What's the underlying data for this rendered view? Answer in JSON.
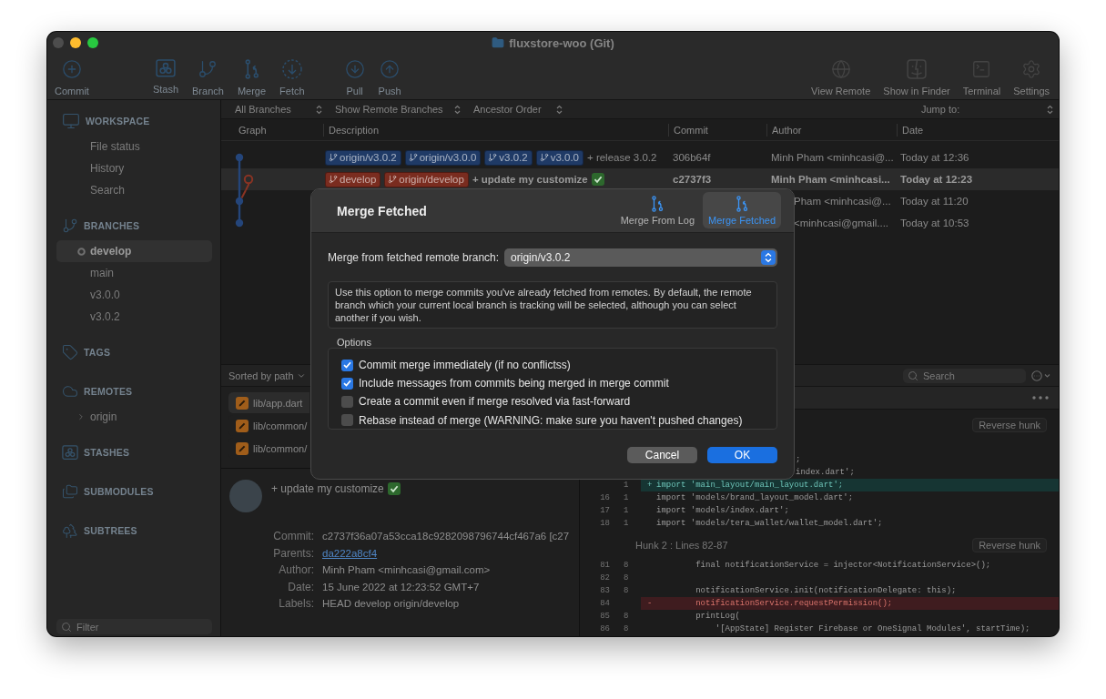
{
  "window": {
    "title": "fluxstore-woo (Git)",
    "controls": [
      {
        "kind": "close",
        "disabled": true
      },
      {
        "kind": "minimize",
        "disabled": false
      },
      {
        "kind": "zoom",
        "disabled": false
      }
    ]
  },
  "toolbar": {
    "groups": [
      [
        "Commit"
      ],
      [
        "Stash",
        "Branch",
        "Merge",
        "Fetch"
      ],
      [
        "Pull",
        "Push"
      ]
    ],
    "right": [
      "View Remote",
      "Show in Finder",
      "Terminal",
      "Settings"
    ]
  },
  "sidebar": {
    "sections": [
      {
        "title": "WORKSPACE",
        "items": [
          {
            "label": "File status",
            "selected": false
          },
          {
            "label": "History",
            "selected": false
          },
          {
            "label": "Search",
            "selected": false
          }
        ]
      },
      {
        "title": "BRANCHES",
        "items": [
          {
            "label": "develop",
            "selected": true,
            "current": true
          },
          {
            "label": "main",
            "selected": false,
            "current": false
          },
          {
            "label": "v3.0.0",
            "selected": false,
            "current": false
          },
          {
            "label": "v3.0.2",
            "selected": false,
            "current": false
          }
        ]
      },
      {
        "title": "TAGS"
      },
      {
        "title": "REMOTES",
        "items": [
          {
            "label": "origin",
            "selected": false,
            "expanded": false
          }
        ]
      },
      {
        "title": "STASHES"
      },
      {
        "title": "SUBMODULES"
      },
      {
        "title": "SUBTREES"
      }
    ],
    "filter": {
      "placeholder": "Filter"
    }
  },
  "view_options": {
    "popups": [
      "All Branches",
      "Show Remote Branches",
      "Ancestor Order"
    ],
    "jump_to": "Jump to:"
  },
  "commits": {
    "columns": [
      "Graph",
      "Description",
      "Commit",
      "Author",
      "Date"
    ],
    "rows": [
      {
        "kind": "tip",
        "refs": [
          {
            "name": "origin/v3.0.2",
            "color": "#1f3a66"
          },
          {
            "name": "origin/v3.0.0",
            "color": "#1f3a66"
          },
          {
            "name": "v3.0.2",
            "color": "#1f3a66"
          },
          {
            "name": "v3.0.0",
            "color": "#1f3a66"
          }
        ],
        "description": "+ release 3.0.2",
        "check_emoji": false,
        "commit": "306b64f",
        "author": "Minh Pham <minhcasi@...",
        "date": "Today at 12:36",
        "selected": false
      },
      {
        "kind": "fork",
        "refs": [
          {
            "name": "develop",
            "color": "#7a2c1f"
          },
          {
            "name": "origin/develop",
            "color": "#7a2c1f"
          }
        ],
        "description": "+ update my customize",
        "check_emoji": true,
        "commit": "c2737f3",
        "author": "Minh Pham <minhcasi...",
        "date": "Today at 12:23",
        "selected": true
      },
      {
        "kind": "join",
        "author": "Pham <minhcasi@...",
        "date": "Today at 11:20",
        "selected": false
      },
      {
        "kind": "end",
        "author": "<minhcasi@gmail....",
        "date": "Today at 10:53",
        "selected": false
      }
    ]
  },
  "merge_dialog": {
    "title": "Merge Fetched",
    "tabs": [
      {
        "label": "Merge From Log",
        "selected": false
      },
      {
        "label": "Merge Fetched",
        "selected": true
      }
    ],
    "branch": {
      "label": "Merge from fetched remote branch:",
      "value": "origin/v3.0.2"
    },
    "help": "Use this option to merge commits you've already fetched from remotes. By default, the remote branch which your current local branch is tracking will be selected, although you can select another if you wish.",
    "options_title": "Options",
    "options": [
      {
        "label": "Commit merge immediately (if no conflictss)",
        "checked": true
      },
      {
        "label": "Include messages from commits being merged in merge commit",
        "checked": true
      },
      {
        "label": "Create a commit even if merge resolved via fast-forward",
        "checked": false
      },
      {
        "label": "Rebase instead of merge (WARNING: make sure you haven't pushed changes)",
        "checked": false
      }
    ],
    "buttons": [
      {
        "label": "Cancel",
        "kind": "secondary"
      },
      {
        "label": "OK",
        "kind": "primary"
      }
    ]
  },
  "file_list": {
    "sort": "Sorted by path",
    "files": [
      {
        "path": "lib/app.dart",
        "selected": true
      },
      {
        "path": "lib/common/",
        "selected": false
      },
      {
        "path": "lib/common/",
        "selected": false
      }
    ]
  },
  "diff_search": {
    "placeholder": "Search"
  },
  "commit_detail": {
    "subject": "+ update my customize",
    "check_emoji": true,
    "fields": [
      {
        "label": "Commit:",
        "value": "c2737f36a07a53cca18c9282098796744cf467a6 [c27",
        "kind": "text"
      },
      {
        "label": "Parents:",
        "value": "da222a8cf4",
        "kind": "link"
      },
      {
        "label": "Author:",
        "value": "Minh Pham <minhcasi@gmail.com>",
        "kind": "text"
      },
      {
        "label": "Date:",
        "value": "15 June 2022 at 12:23:52 GMT+7",
        "kind": "text"
      },
      {
        "label": "Labels:",
        "value": "HEAD develop origin/develop",
        "kind": "text"
      }
    ]
  },
  "diff": {
    "hunks": [
      {
        "button": "Reverse hunk",
        "lines": [
          {
            "kind": "clipped",
            "text": ";"
          },
          {
            "kind": "clipped",
            "text": "index.dart';"
          },
          {
            "kind": "added",
            "new": "1",
            "marker": "+",
            "text": "import 'main_layout/main_layout.dart';"
          },
          {
            "kind": "context",
            "old": "16",
            "new": "1",
            "text": "import 'models/brand_layout_model.dart';"
          },
          {
            "kind": "context",
            "old": "17",
            "new": "1",
            "text": "import 'models/index.dart';"
          },
          {
            "kind": "context",
            "old": "18",
            "new": "1",
            "text": "import 'models/tera_wallet/wallet_model.dart';"
          }
        ]
      },
      {
        "title": "Hunk 2 : Lines 82-87",
        "button": "Reverse hunk",
        "lines": [
          {
            "kind": "context",
            "old": "81",
            "new": "8",
            "text": "        final notificationService = injector<NotificationService>();"
          },
          {
            "kind": "context",
            "old": "82",
            "new": "8"
          },
          {
            "kind": "context",
            "old": "83",
            "new": "8",
            "text": "        notificationService.init(notificationDelegate: this);"
          },
          {
            "kind": "removed",
            "old": "84",
            "marker": "-",
            "text": "        notificationService.requestPermission();"
          },
          {
            "kind": "context",
            "old": "85",
            "new": "8",
            "text": "        printLog("
          },
          {
            "kind": "context",
            "old": "86",
            "new": "8",
            "text": "            '[AppState] Register Firebase or OneSignal Modules', startTime);"
          }
        ]
      }
    ]
  }
}
